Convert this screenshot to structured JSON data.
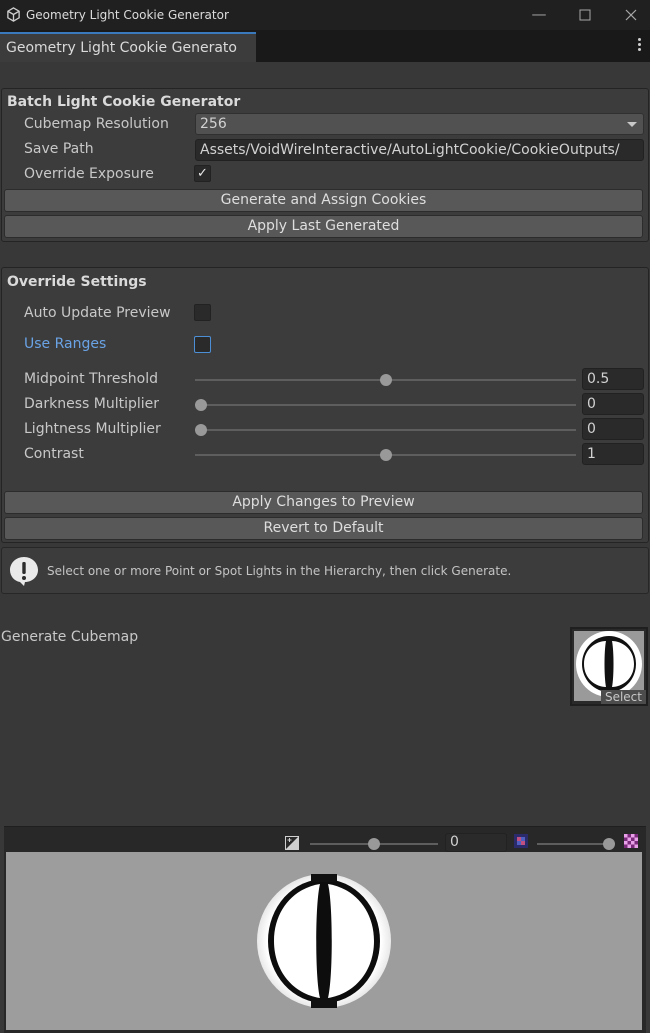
{
  "window": {
    "title": "Geometry Light Cookie Generator",
    "minimize_icon": "minimize-icon",
    "maximize_icon": "maximize-icon",
    "close_icon": "close-icon"
  },
  "tab": {
    "label": "Geometry Light Cookie Generato",
    "menu_icon": "kebab-menu-icon"
  },
  "batch": {
    "title": "Batch Light Cookie Generator",
    "cubemap_resolution_label": "Cubemap Resolution",
    "cubemap_resolution_value": "256",
    "save_path_label": "Save Path",
    "save_path_value": "Assets/VoidWireInteractive/AutoLightCookie/CookieOutputs/",
    "override_exposure_label": "Override Exposure",
    "override_exposure_checked": true,
    "generate_button": "Generate and Assign Cookies",
    "apply_last_button": "Apply Last Generated"
  },
  "override": {
    "title": "Override Settings",
    "auto_update_label": "Auto Update Preview",
    "auto_update_checked": false,
    "use_ranges_label": "Use Ranges",
    "use_ranges_checked": false,
    "sliders": [
      {
        "label": "Midpoint Threshold",
        "value": "0.5",
        "fraction": 0.5
      },
      {
        "label": "Darkness Multiplier",
        "value": "0",
        "fraction": 0
      },
      {
        "label": "Lightness Multiplier",
        "value": "0",
        "fraction": 0
      },
      {
        "label": "Contrast",
        "value": "1",
        "fraction": 0.5
      }
    ],
    "apply_preview_button": "Apply Changes to Preview",
    "revert_button": "Revert to Default"
  },
  "help": {
    "icon": "warning-exclamation-icon",
    "message": "Select one or more Point or Spot Lights in the Hierarchy, then click Generate."
  },
  "cubemap": {
    "label": "Generate Cubemap",
    "select_label": "Select"
  },
  "preview": {
    "exposure_icon": "exposure-icon",
    "mip_value": "0",
    "mip_fraction": 0.5,
    "mip_low_icon": "mip-low-icon",
    "mip_high_icon": "mip-high-icon",
    "zoom_fraction": 1.0
  },
  "colors": {
    "accent": "#3a79bb",
    "link_blue": "#6aa3e6"
  }
}
